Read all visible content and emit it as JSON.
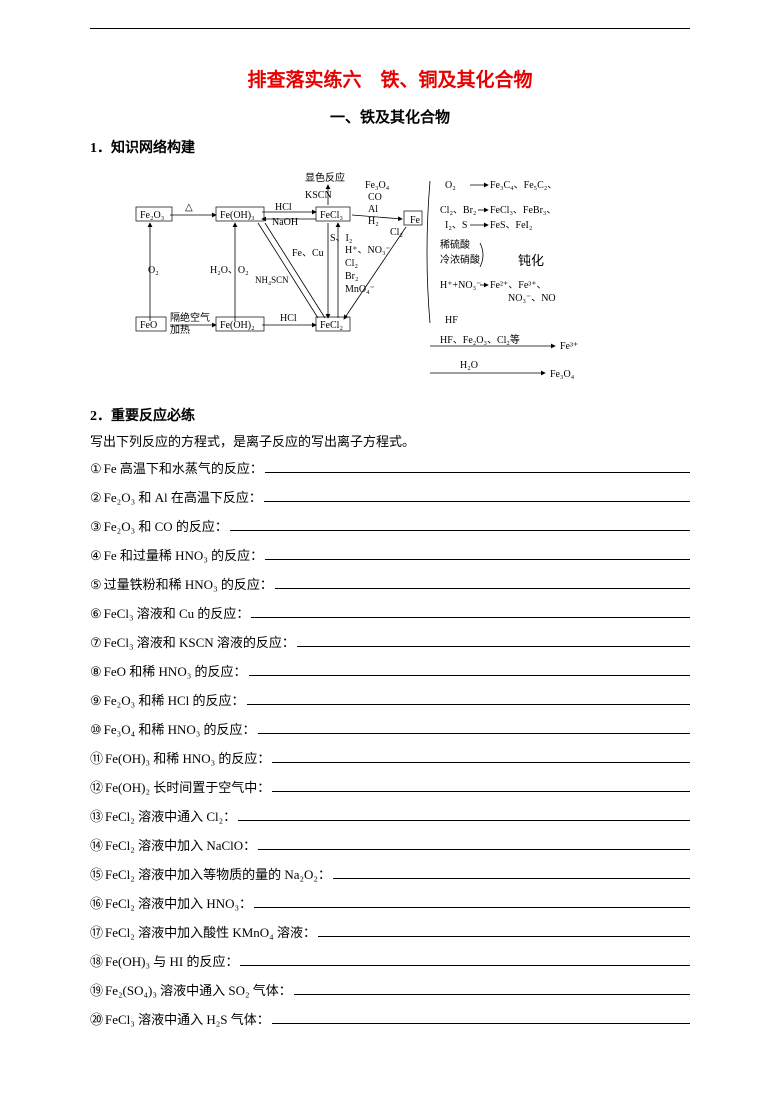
{
  "title": "排查落实练六　铁、铜及其化合物",
  "subtitle": "一、铁及其化合物",
  "section1": "1．知识网络构建",
  "diagram": {
    "Fe2O3": "Fe₂O₃",
    "FeO": "FeO",
    "FeOH3": "Fe(OH)₃",
    "FeOH2": "Fe(OH)₂",
    "FeCl3": "FeCl₃",
    "FeCl2": "FeCl₂",
    "Fe": "Fe",
    "Fe3O4": "Fe₃O₄",
    "delta": "△",
    "O2": "O₂",
    "H2O_O2": "H₂O、O₂",
    "gejue": "隔绝空气",
    "jiare": "加热",
    "HCl": "HCl",
    "NaOH": "NaOH",
    "xianse": "显色反应",
    "KSCN": "KSCN",
    "S_I2": "S、I₂",
    "Fe_Cu": "Fe、Cu",
    "H_NO3": "H⁺、NO₃⁻",
    "Cl2lbl": "Cl₂",
    "Br2": "Br₂",
    "MnO4": "MnO₄⁻",
    "NH4SCN": "NH₄SCN",
    "HNO3_label": "H⁺+NO₃⁻",
    "COa": "CO",
    "Al": "Al",
    "H2": "H₂",
    "Cl2b": "Cl₂",
    "top_r1": "Fe₃C₄、Fe₅C₂、",
    "Cl2_Br2_r": "Cl₂、Br₂",
    "r_FeCl3_FeBr3": "FeCl₃、FeBr₃、",
    "I2_S_r": "I₂、S",
    "r_FeS_FeI2": "FeS、FeI₂",
    "xishao": "稀硫酸",
    "r_dunhua": "钝化",
    "lengnong": "冷浓硝酸",
    "r_Fe2_Fe3": "Fe²⁺、Fe³⁺、",
    "r_NO3_NO": "NO₃⁻、NO",
    "HF": "HF",
    "bottom_arrow_label": "HF、Fe₂O₃、Cl₂等",
    "arrow_Fe3p": "Fe³⁺",
    "H2Ob": "H₂O",
    "arrow_Fe3O4": "Fe₃O₄"
  },
  "section2": "2．重要反应必练",
  "intro": "写出下列反应的方程式，是离子反应的写出离子方程式。",
  "questions": [
    {
      "n": "①",
      "t": "Fe 高温下和水蒸气的反应："
    },
    {
      "n": "②",
      "t": "Fe₂O₃ 和 Al 在高温下反应："
    },
    {
      "n": "③",
      "t": "Fe₂O₃ 和 CO 的反应："
    },
    {
      "n": "④",
      "t": "Fe 和过量稀 HNO₃ 的反应："
    },
    {
      "n": "⑤",
      "t": "过量铁粉和稀 HNO₃ 的反应："
    },
    {
      "n": "⑥",
      "t": "FeCl₃ 溶液和 Cu 的反应："
    },
    {
      "n": "⑦",
      "t": "FeCl₃ 溶液和 KSCN 溶液的反应："
    },
    {
      "n": "⑧",
      "t": "FeO 和稀 HNO₃ 的反应："
    },
    {
      "n": "⑨",
      "t": "Fe₂O₃ 和稀 HCl 的反应："
    },
    {
      "n": "⑩",
      "t": "Fe₃O₄ 和稀 HNO₃ 的反应："
    },
    {
      "n": "⑪",
      "t": "Fe(OH)₃ 和稀 HNO₃ 的反应："
    },
    {
      "n": "⑫",
      "t": "Fe(OH)₂ 长时间置于空气中："
    },
    {
      "n": "⑬",
      "t": "FeCl₂ 溶液中通入 Cl₂："
    },
    {
      "n": "⑭",
      "t": "FeCl₂ 溶液中加入 NaClO："
    },
    {
      "n": "⑮",
      "t": "FeCl₂ 溶液中加入等物质的量的 Na₂O₂："
    },
    {
      "n": "⑯",
      "t": "FeCl₂ 溶液中加入 HNO₃："
    },
    {
      "n": "⑰",
      "t": "FeCl₂ 溶液中加入酸性 KMnO₄ 溶液："
    },
    {
      "n": "⑱",
      "t": "Fe(OH)₃ 与 HI 的反应："
    },
    {
      "n": "⑲",
      "t": "Fe₂(SO₄)₃ 溶液中通入 SO₂ 气体："
    },
    {
      "n": "⑳",
      "t": "FeCl₃ 溶液中通入 H₂S 气体："
    }
  ]
}
